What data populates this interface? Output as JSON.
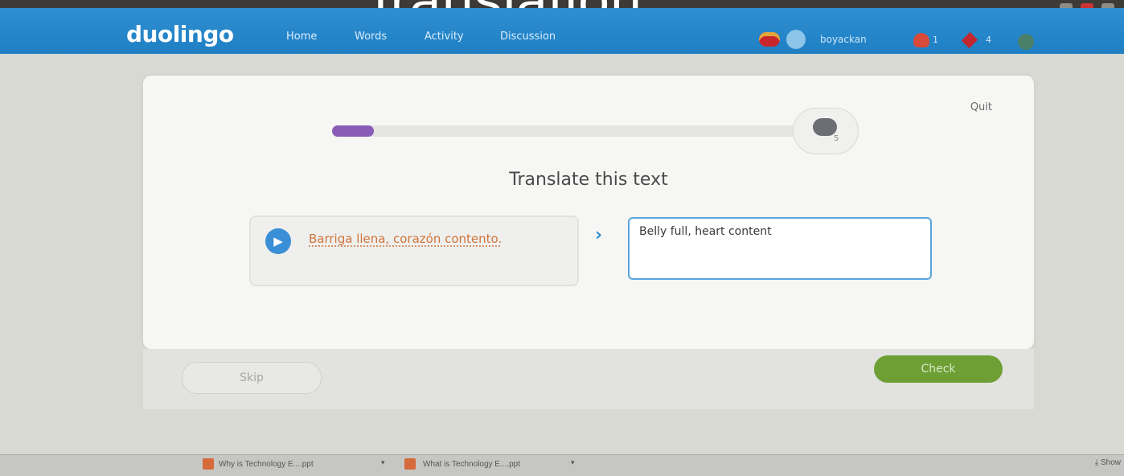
{
  "overlay": {
    "title": "translation"
  },
  "header": {
    "logo": "duolingo",
    "nav": [
      "Home",
      "Words",
      "Activity",
      "Discussion"
    ],
    "username": "boyackan",
    "streak_count": "1",
    "gem_count": "4",
    "brand_color": "#1f7fc4"
  },
  "lesson": {
    "quit_label": "Quit",
    "progress_fraction": 0.09,
    "trophy_number": "5",
    "heading": "Translate this text",
    "source_sentence": "Barriga llena, corazón contento.",
    "answer_value": "Belly full, heart content",
    "skip_label": "Skip",
    "check_label": "Check"
  },
  "download_bar": {
    "items": [
      "Why is Technology E....ppt",
      "What is Technology E....ppt"
    ],
    "show_all_label": "Show"
  },
  "icons": {
    "speaker": "speaker-icon",
    "arrow": "chevron-right-icon",
    "flag": "spanish-flag-icon",
    "streak": "streak-flame-icon",
    "gem": "lingot-gem-icon",
    "bell": "notification-bell-icon",
    "trophy": "trophy-icon"
  }
}
